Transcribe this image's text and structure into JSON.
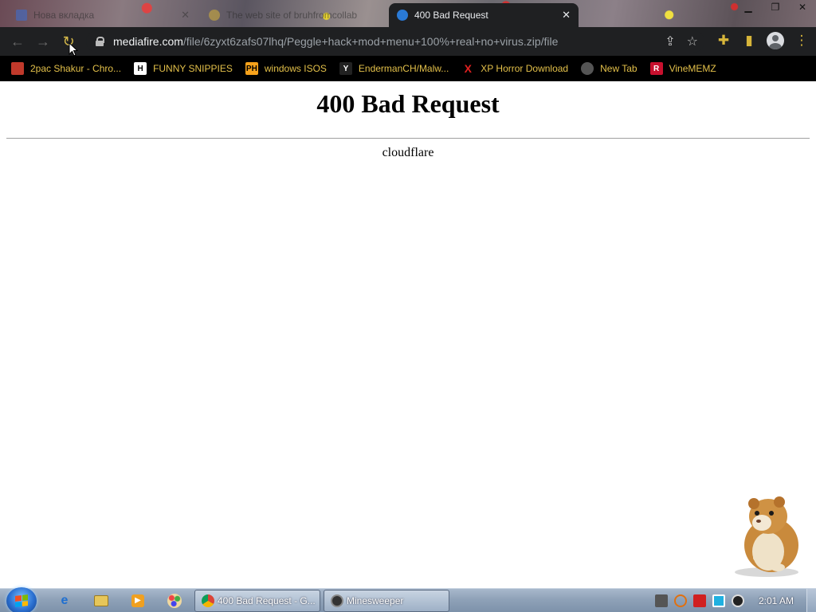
{
  "tabs": [
    {
      "title": "Нова вкладка",
      "state": "inactive"
    },
    {
      "title": "The web site of bruhfromcollab",
      "state": "inactive"
    },
    {
      "title": "400 Bad Request",
      "state": "active"
    }
  ],
  "toolbar": {
    "url_host": "mediafire.com",
    "url_path": "/file/6zyxt6zafs07lhq/Peggle+hack+mod+menu+100%+real+no+virus.zip/file"
  },
  "bookmarks": [
    {
      "label": "2pac Shakur - Chro...",
      "icon": "bookmark-favicon"
    },
    {
      "label": "FUNNY SNIPPIES",
      "icon": "H"
    },
    {
      "label": "windows ISOS",
      "icon": "PH"
    },
    {
      "label": "EndermanCH/Malw...",
      "icon": "Y"
    },
    {
      "label": "XP Horror Download",
      "icon": "X"
    },
    {
      "label": "New Tab",
      "icon": "globe-icon"
    },
    {
      "label": "VineMEMZ",
      "icon": "R"
    }
  ],
  "page": {
    "heading": "400 Bad Request",
    "server": "cloudflare"
  },
  "taskbar": {
    "tasks": [
      {
        "label": "400 Bad Request - G..."
      },
      {
        "label": "Minesweeper"
      }
    ],
    "clock": "2:01 AM"
  },
  "colors": {
    "chrome_toolbar": "#1f2022",
    "bookmark_text": "#e3c04a",
    "page_bg": "#ffffff"
  }
}
